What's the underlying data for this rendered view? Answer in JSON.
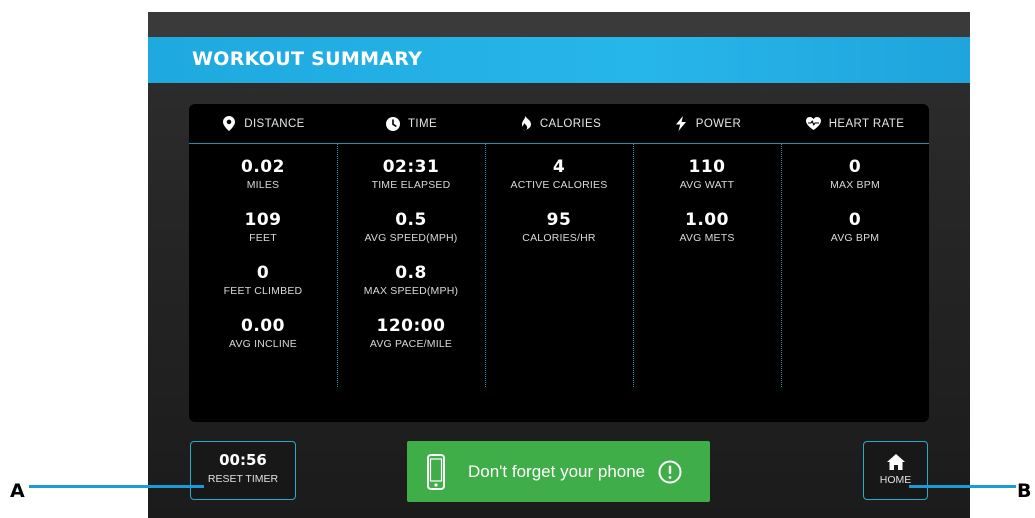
{
  "header": {
    "title": "WORKOUT SUMMARY"
  },
  "columns": [
    {
      "heading": "DISTANCE",
      "icon": "location-pin-icon",
      "metrics": [
        {
          "value": "0.02",
          "label": "MILES"
        },
        {
          "value": "109",
          "label": "FEET"
        },
        {
          "value": "0",
          "label": "FEET CLIMBED"
        },
        {
          "value": "0.00",
          "label": "AVG INCLINE"
        }
      ]
    },
    {
      "heading": "TIME",
      "icon": "clock-icon",
      "metrics": [
        {
          "value": "02:31",
          "label": "TIME ELAPSED"
        },
        {
          "value": "0.5",
          "label": "AVG SPEED(MPH)"
        },
        {
          "value": "0.8",
          "label": "MAX SPEED(MPH)"
        },
        {
          "value": "120:00",
          "label": "AVG PACE/MILE"
        }
      ]
    },
    {
      "heading": "CALORIES",
      "icon": "flame-icon",
      "metrics": [
        {
          "value": "4",
          "label": "ACTIVE CALORIES"
        },
        {
          "value": "95",
          "label": "CALORIES/HR"
        }
      ]
    },
    {
      "heading": "POWER",
      "icon": "lightning-bolt-icon",
      "metrics": [
        {
          "value": "110",
          "label": "AVG WATT"
        },
        {
          "value": "1.00",
          "label": "AVG METS"
        }
      ]
    },
    {
      "heading": "HEART RATE",
      "icon": "heart-rate-icon",
      "metrics": [
        {
          "value": "0",
          "label": "MAX BPM"
        },
        {
          "value": "0",
          "label": "AVG BPM"
        }
      ]
    }
  ],
  "reset_timer": {
    "time": "00:56",
    "label": "RESET TIMER"
  },
  "phone_banner": {
    "message": "Don't forget your phone",
    "icon": "smartphone-icon",
    "alert_icon": "exclamation-circle-icon"
  },
  "home": {
    "label": "HOME",
    "icon": "home-icon"
  },
  "callouts": {
    "left": "A",
    "right": "B"
  },
  "colors": {
    "header_blue": "#27b6ea",
    "accent_teal": "#2aa9c9",
    "banner_green": "#3fae49",
    "callout_blue": "#1a9ad6"
  }
}
